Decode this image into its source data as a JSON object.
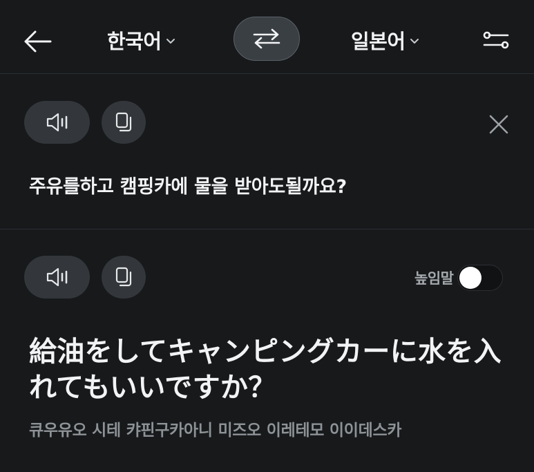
{
  "header": {
    "source_lang": "한국어",
    "target_lang": "일본어"
  },
  "source": {
    "text": "주유를하고 캠핑카에 물을 받아도될까요?"
  },
  "result": {
    "honorific_label": "높임말",
    "honorific_on": false,
    "text": "給油をしてキャンピングカーに水を入れてもいいですか？",
    "pronunciation": "큐우유오 시테 캬핀구카아니 미즈오 이레테모 이이데스카"
  },
  "colors": {
    "background": "#17191b",
    "pill": "#33373b",
    "swap": "#3a3f44",
    "text": "#f2f3f4",
    "muted": "#8d9296"
  },
  "icons": [
    "back-arrow-icon",
    "chevron-down-icon",
    "swap-arrows-icon",
    "settings-sliders-icon",
    "speaker-icon",
    "copy-icon",
    "close-icon"
  ]
}
